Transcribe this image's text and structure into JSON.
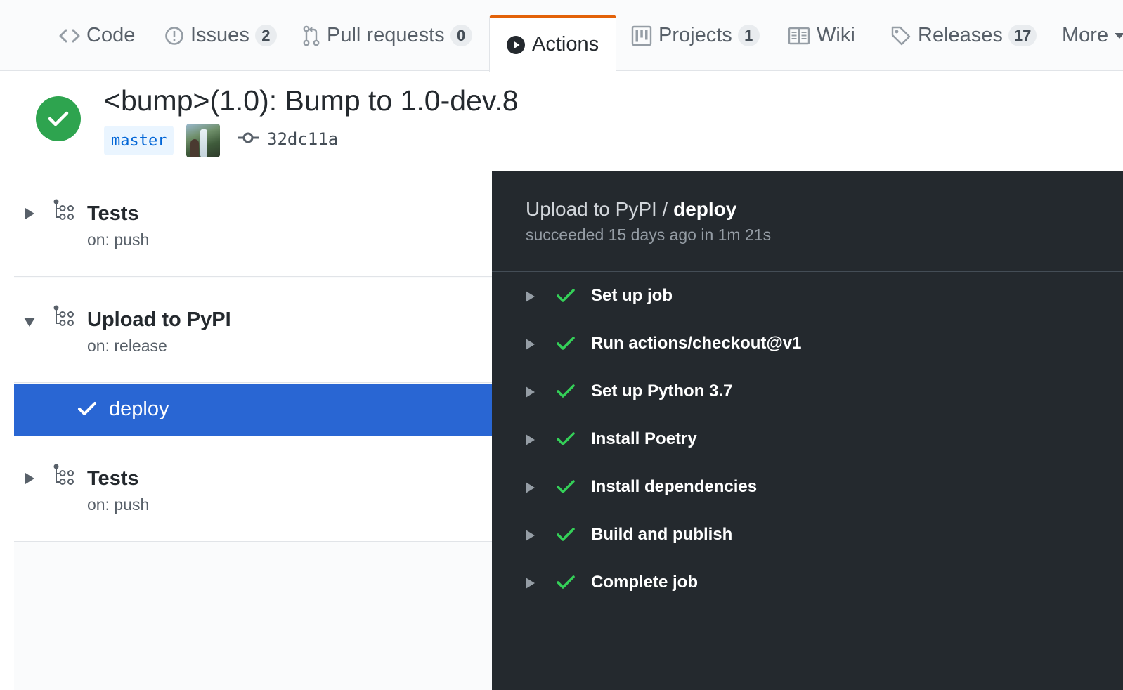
{
  "tabs": [
    {
      "label": "Code",
      "icon": "code-icon"
    },
    {
      "label": "Issues",
      "count": "2",
      "icon": "issue-icon"
    },
    {
      "label": "Pull requests",
      "count": "0",
      "icon": "pull-request-icon"
    },
    {
      "label": "Actions",
      "icon": "play-icon",
      "selected": true
    },
    {
      "label": "Projects",
      "count": "1",
      "icon": "project-icon"
    },
    {
      "label": "Wiki",
      "icon": "book-icon"
    },
    {
      "label": "Releases",
      "count": "17",
      "icon": "tag-icon"
    },
    {
      "label": "More",
      "icon": "caret-down-icon"
    }
  ],
  "run": {
    "title": "<bump>(1.0): Bump to 1.0-dev.8",
    "status": "success",
    "branch": "master",
    "commit_sha": "32dc11a"
  },
  "workflows": [
    {
      "name": "Tests",
      "trigger": "on: push",
      "expanded": false
    },
    {
      "name": "Upload to PyPI",
      "trigger": "on: release",
      "expanded": true,
      "jobs": [
        {
          "name": "deploy",
          "status": "success",
          "selected": true
        }
      ]
    },
    {
      "name": "Tests",
      "trigger": "on: push",
      "expanded": false
    }
  ],
  "job_panel": {
    "workflow": "Upload to PyPI",
    "separator": " / ",
    "job": "deploy",
    "summary": "succeeded 15 days ago in 1m 21s",
    "steps": [
      {
        "name": "Set up job",
        "status": "success"
      },
      {
        "name": "Run actions/checkout@v1",
        "status": "success"
      },
      {
        "name": "Set up Python 3.7",
        "status": "success"
      },
      {
        "name": "Install Poetry",
        "status": "success"
      },
      {
        "name": "Install dependencies",
        "status": "success"
      },
      {
        "name": "Build and publish",
        "status": "success"
      },
      {
        "name": "Complete job",
        "status": "success"
      }
    ]
  },
  "colors": {
    "success": "#2ea44f",
    "selected_job_bg": "#2966d3",
    "active_tab_accent": "#e36209",
    "panel_bg": "#24292e"
  }
}
